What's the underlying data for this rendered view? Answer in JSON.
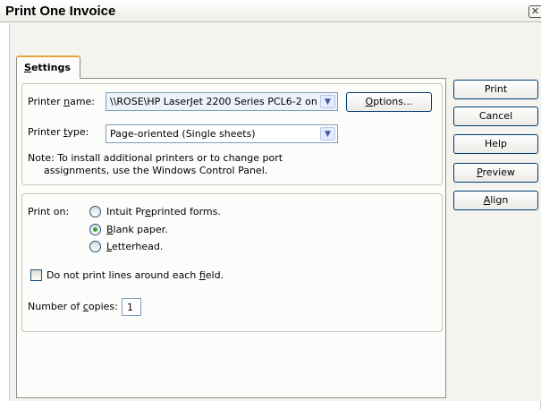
{
  "window": {
    "title": "Print One Invoice",
    "close_glyph": "✕"
  },
  "tab": {
    "label_pre": "",
    "label_key": "S",
    "label_post": "ettings"
  },
  "printer": {
    "name_label_pre": "Printer ",
    "name_label_key": "n",
    "name_label_post": "ame:",
    "name_value": "\\\\ROSE\\HP LaserJet 2200 Series PCL6-2 on",
    "type_label_pre": "Printer ",
    "type_label_key": "t",
    "type_label_post": "ype:",
    "type_value": "Page-oriented (Single sheets)",
    "note_line1": "Note: To install additional printers or to change port",
    "note_line2": "assignments, use the Windows Control Panel."
  },
  "options_button": {
    "pre": "",
    "key": "O",
    "post": "ptions..."
  },
  "print_on": {
    "label": "Print on:",
    "options": [
      {
        "pre": "Intuit Pr",
        "key": "e",
        "post": "printed forms.",
        "selected": false
      },
      {
        "pre": "",
        "key": "B",
        "post": "lank paper.",
        "selected": true
      },
      {
        "pre": "",
        "key": "L",
        "post": "etterhead.",
        "selected": false
      }
    ]
  },
  "no_lines": {
    "pre": "Do not print lines around each ",
    "key": "f",
    "post": "ield.",
    "checked": false
  },
  "copies": {
    "label_pre": "Number of ",
    "label_key": "c",
    "label_post": "opies:",
    "value": "1"
  },
  "side_buttons": [
    {
      "pre": "Print",
      "key": "",
      "post": ""
    },
    {
      "pre": "Cancel",
      "key": "",
      "post": ""
    },
    {
      "pre": "Help",
      "key": "",
      "post": ""
    },
    {
      "pre": "",
      "key": "P",
      "post": "review"
    },
    {
      "pre": "",
      "key": "A",
      "post": "lign"
    }
  ],
  "dropdown_glyph": "▼",
  "icons": {
    "close": "close-icon",
    "dropdown": "chevron-down-icon"
  }
}
